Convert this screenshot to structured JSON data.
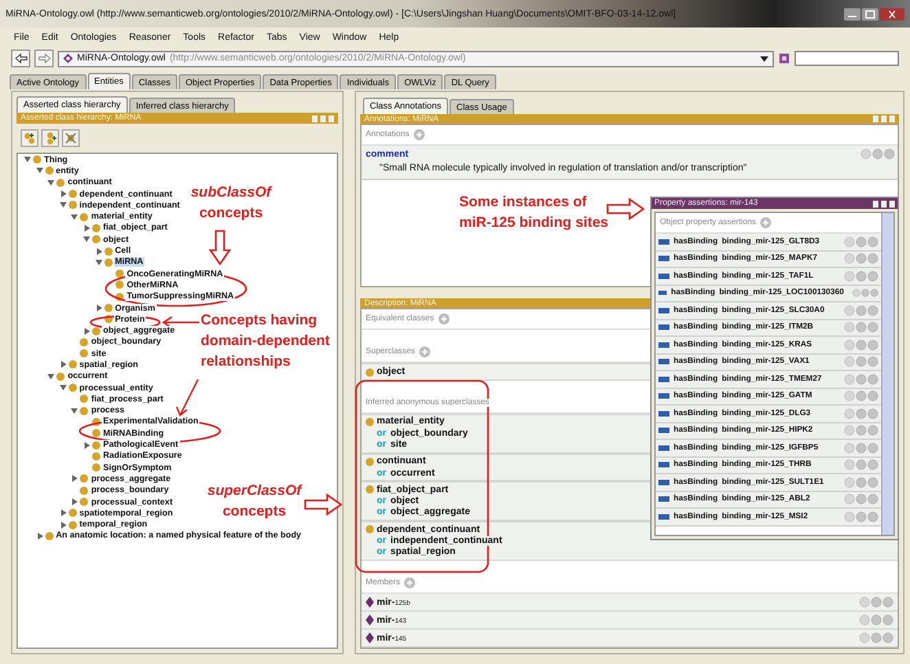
{
  "window": {
    "title": "MiRNA-Ontology.owl (http://www.semanticweb.org/ontologies/2010/2/MiRNA-Ontology.owl) - [C:\\Users\\Jingshan Huang\\Documents\\OMIT-BFO-03-14-12.owl]"
  },
  "menu": [
    "File",
    "Edit",
    "Ontologies",
    "Reasoner",
    "Tools",
    "Refactor",
    "Tabs",
    "View",
    "Window",
    "Help"
  ],
  "address": {
    "ontology": "MiRNA-Ontology.owl",
    "iri": "(http://www.semanticweb.org/ontologies/2010/2/MiRNA-Ontology.owl)"
  },
  "main_tabs": [
    {
      "label": "Active Ontology",
      "selected": false
    },
    {
      "label": "Entities",
      "selected": true
    },
    {
      "label": "Classes",
      "selected": false
    },
    {
      "label": "Object Properties",
      "selected": false
    },
    {
      "label": "Data Properties",
      "selected": false
    },
    {
      "label": "Individuals",
      "selected": false
    },
    {
      "label": "OWLViz",
      "selected": false
    },
    {
      "label": "DL Query",
      "selected": false
    }
  ],
  "left": {
    "tabs": [
      {
        "label": "Asserted class hierarchy",
        "selected": true
      },
      {
        "label": "Inferred class hierarchy",
        "selected": false
      }
    ],
    "panel_title": "Asserted class hierarchy: MiRNA",
    "tree": [
      {
        "label": "Thing",
        "expanded": true,
        "selected": false,
        "children": [
          {
            "label": "entity",
            "expanded": true,
            "selected": false,
            "children": [
              {
                "label": "continuant",
                "expanded": true,
                "selected": false,
                "children": [
                  {
                    "label": "dependent_continuant",
                    "expanded": false,
                    "selected": false
                  },
                  {
                    "label": "independent_continuant",
                    "expanded": true,
                    "selected": false,
                    "children": [
                      {
                        "label": "material_entity",
                        "expanded": true,
                        "selected": false,
                        "children": [
                          {
                            "label": "fiat_object_part",
                            "expanded": false,
                            "selected": false
                          },
                          {
                            "label": "object",
                            "expanded": true,
                            "selected": false,
                            "children": [
                              {
                                "label": "Cell",
                                "expanded": false,
                                "selected": false
                              },
                              {
                                "label": "MiRNA",
                                "expanded": true,
                                "selected": true,
                                "children": [
                                  {
                                    "label": "OncoGeneratingMiRNA",
                                    "selected": false
                                  },
                                  {
                                    "label": "OtherMiRNA",
                                    "selected": false
                                  },
                                  {
                                    "label": "TumorSuppressingMiRNA",
                                    "selected": false
                                  }
                                ]
                              },
                              {
                                "label": "Organism",
                                "expanded": false,
                                "selected": false
                              },
                              {
                                "label": "Protein",
                                "selected": false
                              }
                            ]
                          },
                          {
                            "label": "object_aggregate",
                            "expanded": false,
                            "selected": false
                          }
                        ]
                      },
                      {
                        "label": "object_boundary",
                        "selected": false
                      },
                      {
                        "label": "site",
                        "selected": false
                      }
                    ]
                  },
                  {
                    "label": "spatial_region",
                    "expanded": false,
                    "selected": false
                  }
                ]
              },
              {
                "label": "occurrent",
                "expanded": true,
                "selected": false,
                "children": [
                  {
                    "label": "processual_entity",
                    "expanded": true,
                    "selected": false,
                    "children": [
                      {
                        "label": "fiat_process_part",
                        "selected": false
                      },
                      {
                        "label": "process",
                        "expanded": true,
                        "selected": false,
                        "children": [
                          {
                            "label": "ExperimentalValidation",
                            "selected": false
                          },
                          {
                            "label": "MiRNABinding",
                            "selected": false
                          },
                          {
                            "label": "PathologicalEvent",
                            "expanded": false,
                            "selected": false
                          },
                          {
                            "label": "RadiationExposure",
                            "selected": false
                          },
                          {
                            "label": "SignOrSymptom",
                            "selected": false
                          }
                        ]
                      },
                      {
                        "label": "process_aggregate",
                        "expanded": false,
                        "selected": false
                      },
                      {
                        "label": "process_boundary",
                        "selected": false
                      },
                      {
                        "label": "processual_context",
                        "expanded": false,
                        "selected": false
                      }
                    ]
                  },
                  {
                    "label": "spatiotemporal_region",
                    "expanded": false,
                    "selected": false
                  },
                  {
                    "label": "temporal_region",
                    "expanded": false,
                    "selected": false
                  }
                ]
              }
            ]
          },
          {
            "label": "An anatomic location: a named physical feature of the body",
            "expanded": false,
            "selected": false
          }
        ]
      }
    ]
  },
  "right": {
    "tabs": [
      {
        "label": "Class Annotations",
        "selected": true
      },
      {
        "label": "Class Usage",
        "selected": false
      }
    ],
    "annotations_title": "Annotations: MiRNA",
    "annotations_header": "Annotations",
    "comment": {
      "property": "comment",
      "value": "\"Small RNA molecule typically involved in regulation of translation and/or transcription\""
    },
    "description_title": "Description: MiRNA",
    "equivalent_header": "Equivalent classes",
    "superclasses_header": "Superclasses",
    "superclasses": [
      {
        "name": "object"
      }
    ],
    "inferred_header": "Inferred anonymous superclasses",
    "inferred": [
      {
        "name": "material_entity",
        "alternatives": [
          {
            "connector": "or",
            "name": "object_boundary"
          },
          {
            "connector": "or",
            "name": "site"
          }
        ]
      },
      {
        "name": "continuant",
        "alternatives": [
          {
            "connector": "or",
            "name": "occurrent"
          }
        ]
      },
      {
        "name": "fiat_object_part",
        "alternatives": [
          {
            "connector": "or",
            "name": "object"
          },
          {
            "connector": "or",
            "name": "object_aggregate"
          }
        ]
      },
      {
        "name": "dependent_continuant",
        "alternatives": [
          {
            "connector": "or",
            "name": "independent_continuant"
          },
          {
            "connector": "or",
            "name": "spatial_region"
          }
        ]
      }
    ],
    "members_header": "Members",
    "members": [
      {
        "prefix": "mir-",
        "number": "125b"
      },
      {
        "prefix": "mir-",
        "number": "143"
      },
      {
        "prefix": "mir-",
        "number": "145"
      }
    ]
  },
  "popup": {
    "title": "Property assertions: mir-143",
    "header": "Object property assertions",
    "rows": [
      {
        "property": "hasBinding",
        "value": "binding_mir-125_GLT8D3"
      },
      {
        "property": "hasBinding",
        "value": "binding_mir-125_MAPK7"
      },
      {
        "property": "hasBinding",
        "value": "binding_mir-125_TAF1L"
      },
      {
        "property": "hasBinding",
        "value": "binding_mir-125_LOC100130360"
      },
      {
        "property": "hasBinding",
        "value": "binding_mir-125_SLC30A0"
      },
      {
        "property": "hasBinding",
        "value": "binding_mir-125_ITM2B"
      },
      {
        "property": "hasBinding",
        "value": "binding_mir-125_KRAS"
      },
      {
        "property": "hasBinding",
        "value": "binding_mir-125_VAX1"
      },
      {
        "property": "hasBinding",
        "value": "binding_mir-125_TMEM27"
      },
      {
        "property": "hasBinding",
        "value": "binding_mir-125_GATM"
      },
      {
        "property": "hasBinding",
        "value": "binding_mir-125_DLG3"
      },
      {
        "property": "hasBinding",
        "value": "binding_mir-125_HIPK2"
      },
      {
        "property": "hasBinding",
        "value": "binding_mir-125_IGFBP5"
      },
      {
        "property": "hasBinding",
        "value": "binding_mir-125_THRB"
      },
      {
        "property": "hasBinding",
        "value": "binding_mir-125_SULT1E1"
      },
      {
        "property": "hasBinding",
        "value": "binding_mir-125_ABL2"
      },
      {
        "property": "hasBinding",
        "value": "binding_mir-125_MSI2"
      }
    ]
  },
  "callouts": [
    {
      "text": "*subClassOf*\nconcepts"
    },
    {
      "text": "Concepts having\ndomain-dependent\nrelationships"
    },
    {
      "text": "Some instances of\nmiR-125 binding sites"
    },
    {
      "text": "*superClassOf*\nconcepts"
    }
  ]
}
